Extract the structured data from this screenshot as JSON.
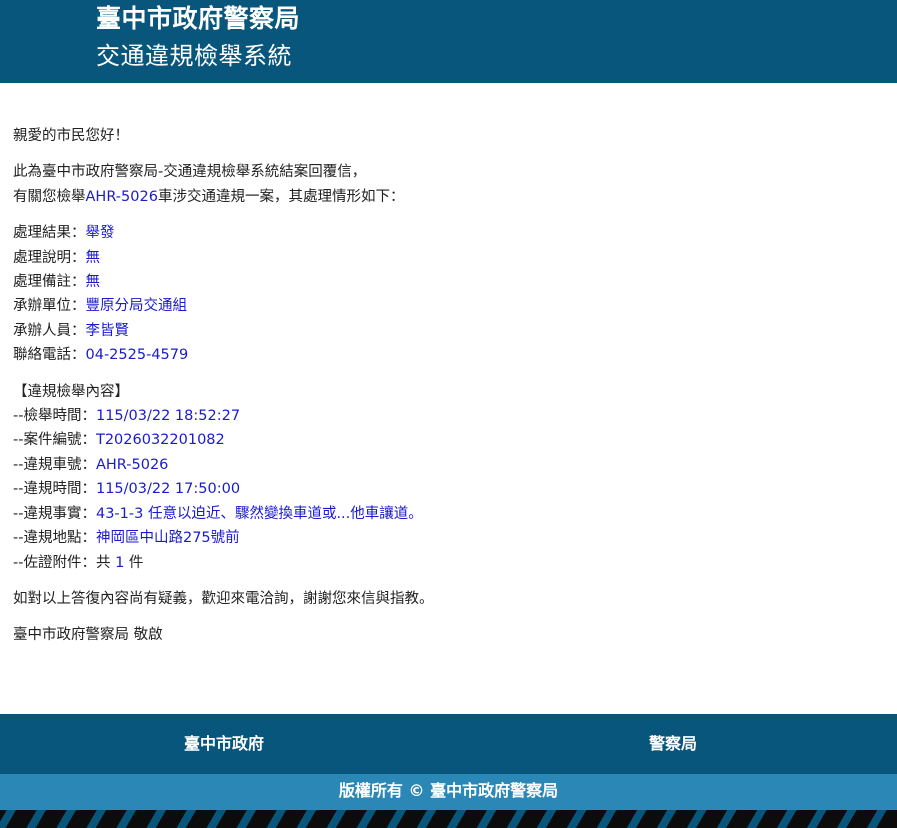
{
  "header": {
    "org": "臺中市政府警察局",
    "system": "交通違規檢舉系統"
  },
  "letter": {
    "greeting": "親愛的市民您好！",
    "intro_line1": "此為臺中市政府警察局-交通違規檢舉系統結案回覆信，",
    "intro_line2_prefix": "有關您檢舉",
    "intro_plate": "AHR-5026",
    "intro_line2_suffix": "車涉交通違規一案，其處理情形如下：",
    "processing": [
      {
        "label": "處理結果：",
        "value": "舉發"
      },
      {
        "label": "處理說明：",
        "value": "無"
      },
      {
        "label": "處理備註：",
        "value": "無"
      },
      {
        "label": "承辦單位：",
        "value": "豐原分局交通組"
      },
      {
        "label": "承辦人員：",
        "value": "李皆賢"
      },
      {
        "label": "聯絡電話：",
        "value": "04-2525-4579"
      }
    ],
    "report_heading": "【違規檢舉內容】",
    "report": [
      {
        "label": "--檢舉時間：",
        "value": "115/03/22 18:52:27"
      },
      {
        "label": "--案件編號：",
        "value": "T2026032201082"
      },
      {
        "label": "--違規車號：",
        "value": "AHR-5026"
      },
      {
        "label": "--違規時間：",
        "value": "115/03/22 17:50:00"
      },
      {
        "label": "--違規事實：",
        "value": "43-1-3 任意以迫近、驟然變換車道或...他車讓道。"
      },
      {
        "label": "--違規地點：",
        "value": "神岡區中山路275號前"
      }
    ],
    "attachment_label": "--佐證附件：共 ",
    "attachment_count": "1",
    "attachment_unit": " 件",
    "closing": "如對以上答復內容尚有疑義，歡迎來電洽詢，謝謝您來信與指教。",
    "signature": "臺中市政府警察局 敬啟"
  },
  "footer": {
    "links": [
      "臺中市政府",
      "警察局"
    ],
    "copyright": "版權所有 © 臺中市政府警察局"
  },
  "colors": {
    "header_bg": "#08567c",
    "copyright_bg": "#2a87b6",
    "value_text": "#1a1ad0"
  }
}
